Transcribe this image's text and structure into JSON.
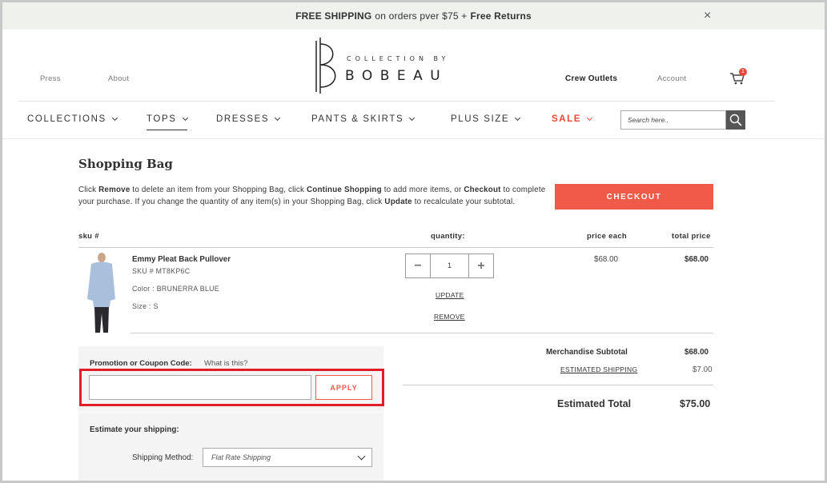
{
  "promo_bar": {
    "free_shipping": "FREE SHIPPING",
    "middle": "on orders pver $75 +",
    "free_returns": "Free Returns",
    "close": "×"
  },
  "header": {
    "press": "Press",
    "about": "About",
    "crew_outlets": "Crew Outlets",
    "account": "Account",
    "cart_count": "1",
    "logo_sub": "COLLECTION BY",
    "logo_main": "BOBEAU"
  },
  "nav": {
    "items": [
      {
        "label": "COLLECTIONS"
      },
      {
        "label": "TOPS"
      },
      {
        "label": "DRESSES"
      },
      {
        "label": "PANTS & SKIRTS"
      },
      {
        "label": "PLUS SIZE"
      },
      {
        "label": "SALE"
      }
    ],
    "search_placeholder": "Search here.."
  },
  "colors": {
    "accent": "#f05a48",
    "highlight": "#e01d28",
    "sale": "#e8473a"
  },
  "bag": {
    "title": "Shopping Bag",
    "intro": {
      "p1": "Click ",
      "remove": "Remove",
      "p2": " to delete an item from your Shopping Bag, click ",
      "continue": "Continue Shopping",
      "p3": " to add more items, or ",
      "checkout": "Checkout",
      "p4": " to complete your purchase. If you change the quantity of any item(s) in your Shopping Bag, click ",
      "update": "Update",
      "p5": " to recalculate your subtotal."
    },
    "checkout_button": "CHECKOUT",
    "columns": {
      "sku": "sku #",
      "quantity": "quantity:",
      "price_each": "price each",
      "total_price": "total price"
    },
    "item": {
      "name": "Emmy Pleat Back Pullover",
      "sku": "SKU # MT8KP6C",
      "color": "Color : BRUNERRA BLUE",
      "size": "Size : S",
      "quantity": "1",
      "minus": "−",
      "plus": "+",
      "update": "UPDATE",
      "remove": "REMOVE",
      "price_each": "$68.00",
      "total_price": "$68.00"
    }
  },
  "promo_panel": {
    "label": "Promotion or Coupon Code:",
    "what": "What is this?",
    "coupon_value": "",
    "apply": "APPLY",
    "estimate_title": "Estimate your shipping:",
    "shipping_method_label": "Shipping Method:",
    "shipping_method_value": "Flat Rate Shipping"
  },
  "totals": {
    "subtotal_label": "Merchandise Subtotal",
    "subtotal_value": "$68.00",
    "shipping_label": "ESTIMATED SHIPPING",
    "shipping_value": "$7.00",
    "total_label": "Estimated Total",
    "total_value": "$75.00"
  }
}
